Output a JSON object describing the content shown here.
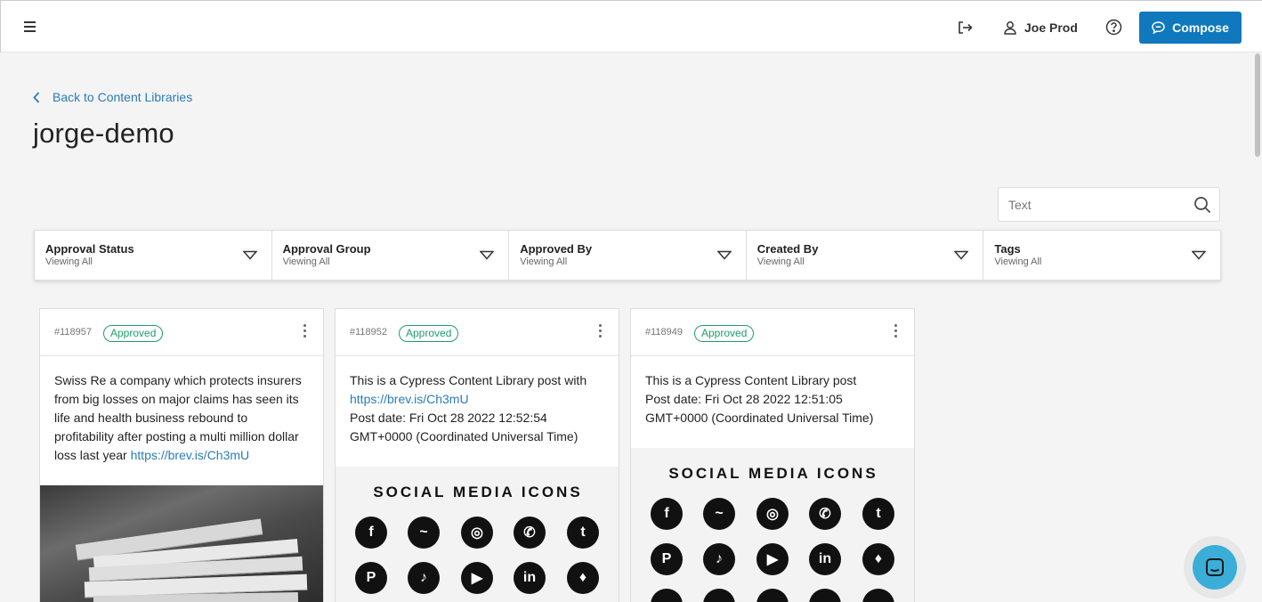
{
  "topbar": {
    "user_name": "Joe Prod",
    "compose_label": "Compose"
  },
  "nav": {
    "back_label": "Back to Content Libraries",
    "page_title": "jorge-demo"
  },
  "search": {
    "placeholder": "Text"
  },
  "filters": [
    {
      "label": "Approval Status",
      "value": "Viewing All"
    },
    {
      "label": "Approval Group",
      "value": "Viewing All"
    },
    {
      "label": "Approved By",
      "value": "Viewing All"
    },
    {
      "label": "Created By",
      "value": "Viewing All"
    },
    {
      "label": "Tags",
      "value": "Viewing All"
    }
  ],
  "cards": [
    {
      "id": "#118957",
      "status": "Approved",
      "text": "Swiss Re a company which protects insurers from big losses on major claims has seen its life and health business rebound to profitability after posting a multi million dollar loss last year ",
      "link": "https://brev.is/Ch3mU"
    },
    {
      "id": "#118952",
      "status": "Approved",
      "text_before": "This is a Cypress Content Library post with ",
      "link": "https://brev.is/Ch3mU",
      "text_after": "Post date: Fri Oct 28 2022 12:52:54 GMT+0000 (Coordinated Universal Time)",
      "image_caption": "SOCIAL MEDIA ICONS"
    },
    {
      "id": "#118949",
      "status": "Approved",
      "text_line1": "This is a Cypress Content Library post",
      "text_line2": "Post date: Fri Oct 28 2022 12:51:05 GMT+0000 (Coordinated Universal Time)",
      "image_caption": "SOCIAL MEDIA ICONS"
    }
  ],
  "colors": {
    "brand_blue": "#1078bd",
    "link_blue": "#2a7cb8",
    "approved_green": "#1e9d6a",
    "chat_blue": "#3aaed8"
  }
}
